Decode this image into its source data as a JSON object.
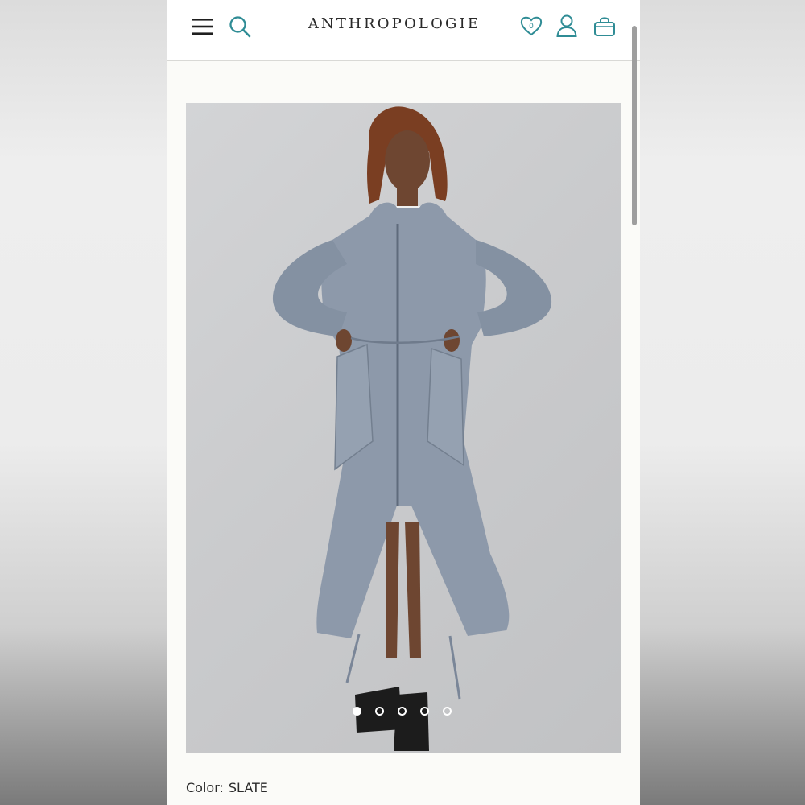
{
  "header": {
    "brand": "ANTHROPOLOGIE",
    "wishlist_count": "0",
    "icons": [
      "menu-icon",
      "search-icon",
      "heart-icon",
      "account-icon",
      "shopping-bag-icon"
    ]
  },
  "product": {
    "gallery": {
      "image_count": 5,
      "active_index": 0
    },
    "color_label": "Color:",
    "color_value": "SLATE"
  },
  "colors": {
    "accent": "#2f8c95",
    "header_bg": "#ffffff",
    "page_bg": "#fbfbf8"
  }
}
